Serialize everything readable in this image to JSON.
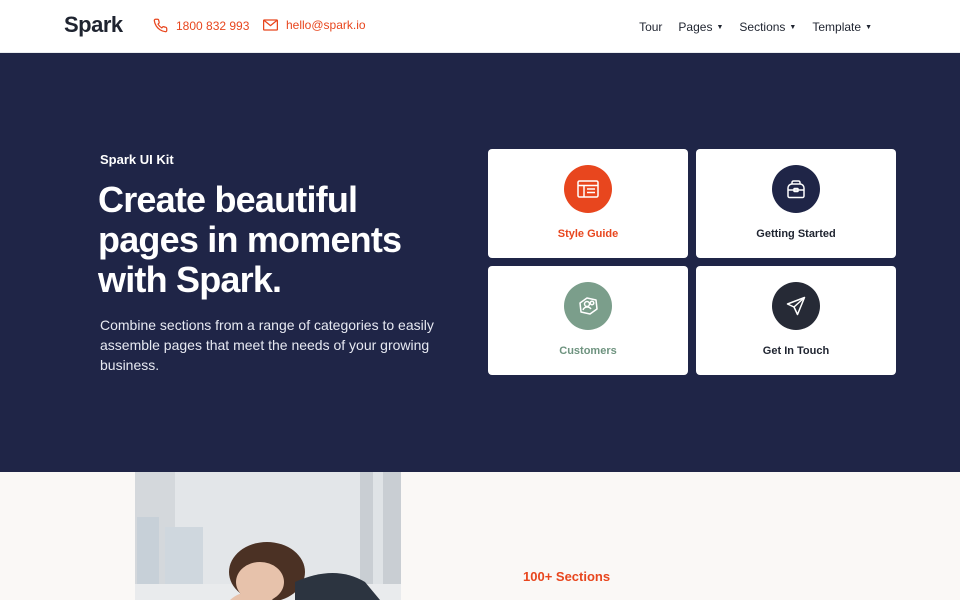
{
  "brand": "Spark",
  "contact": {
    "phone": "1800 832 993",
    "email": "hello@spark.io"
  },
  "nav": {
    "items": [
      {
        "label": "Tour",
        "dropdown": false
      },
      {
        "label": "Pages",
        "dropdown": true
      },
      {
        "label": "Sections",
        "dropdown": true
      },
      {
        "label": "Template",
        "dropdown": true
      }
    ]
  },
  "hero": {
    "eyebrow": "Spark UI Kit",
    "title": "Create beautiful pages in moments with Spark.",
    "subtitle": "Combine sections from a range of categories to easily assemble pages that meet the needs of your growing business."
  },
  "cards": [
    {
      "label": "Style Guide",
      "icon": "browser-window-icon",
      "circle_color": "#e8461e",
      "label_color": "#e8461e"
    },
    {
      "label": "Getting Started",
      "icon": "bag-icon",
      "circle_color": "#1f2547",
      "label_color": "#1f2430"
    },
    {
      "label": "Customers",
      "icon": "customers-icon",
      "circle_color": "#7b9e8b",
      "label_color": "#6e937f"
    },
    {
      "label": "Get In Touch",
      "icon": "paper-plane-icon",
      "circle_color": "#262a36",
      "label_color": "#1f2430"
    }
  ],
  "lower": {
    "section_count": "100+ Sections"
  },
  "colors": {
    "accent": "#e8461e",
    "hero_bg": "#1f2547",
    "lower_bg": "#faf8f6"
  }
}
